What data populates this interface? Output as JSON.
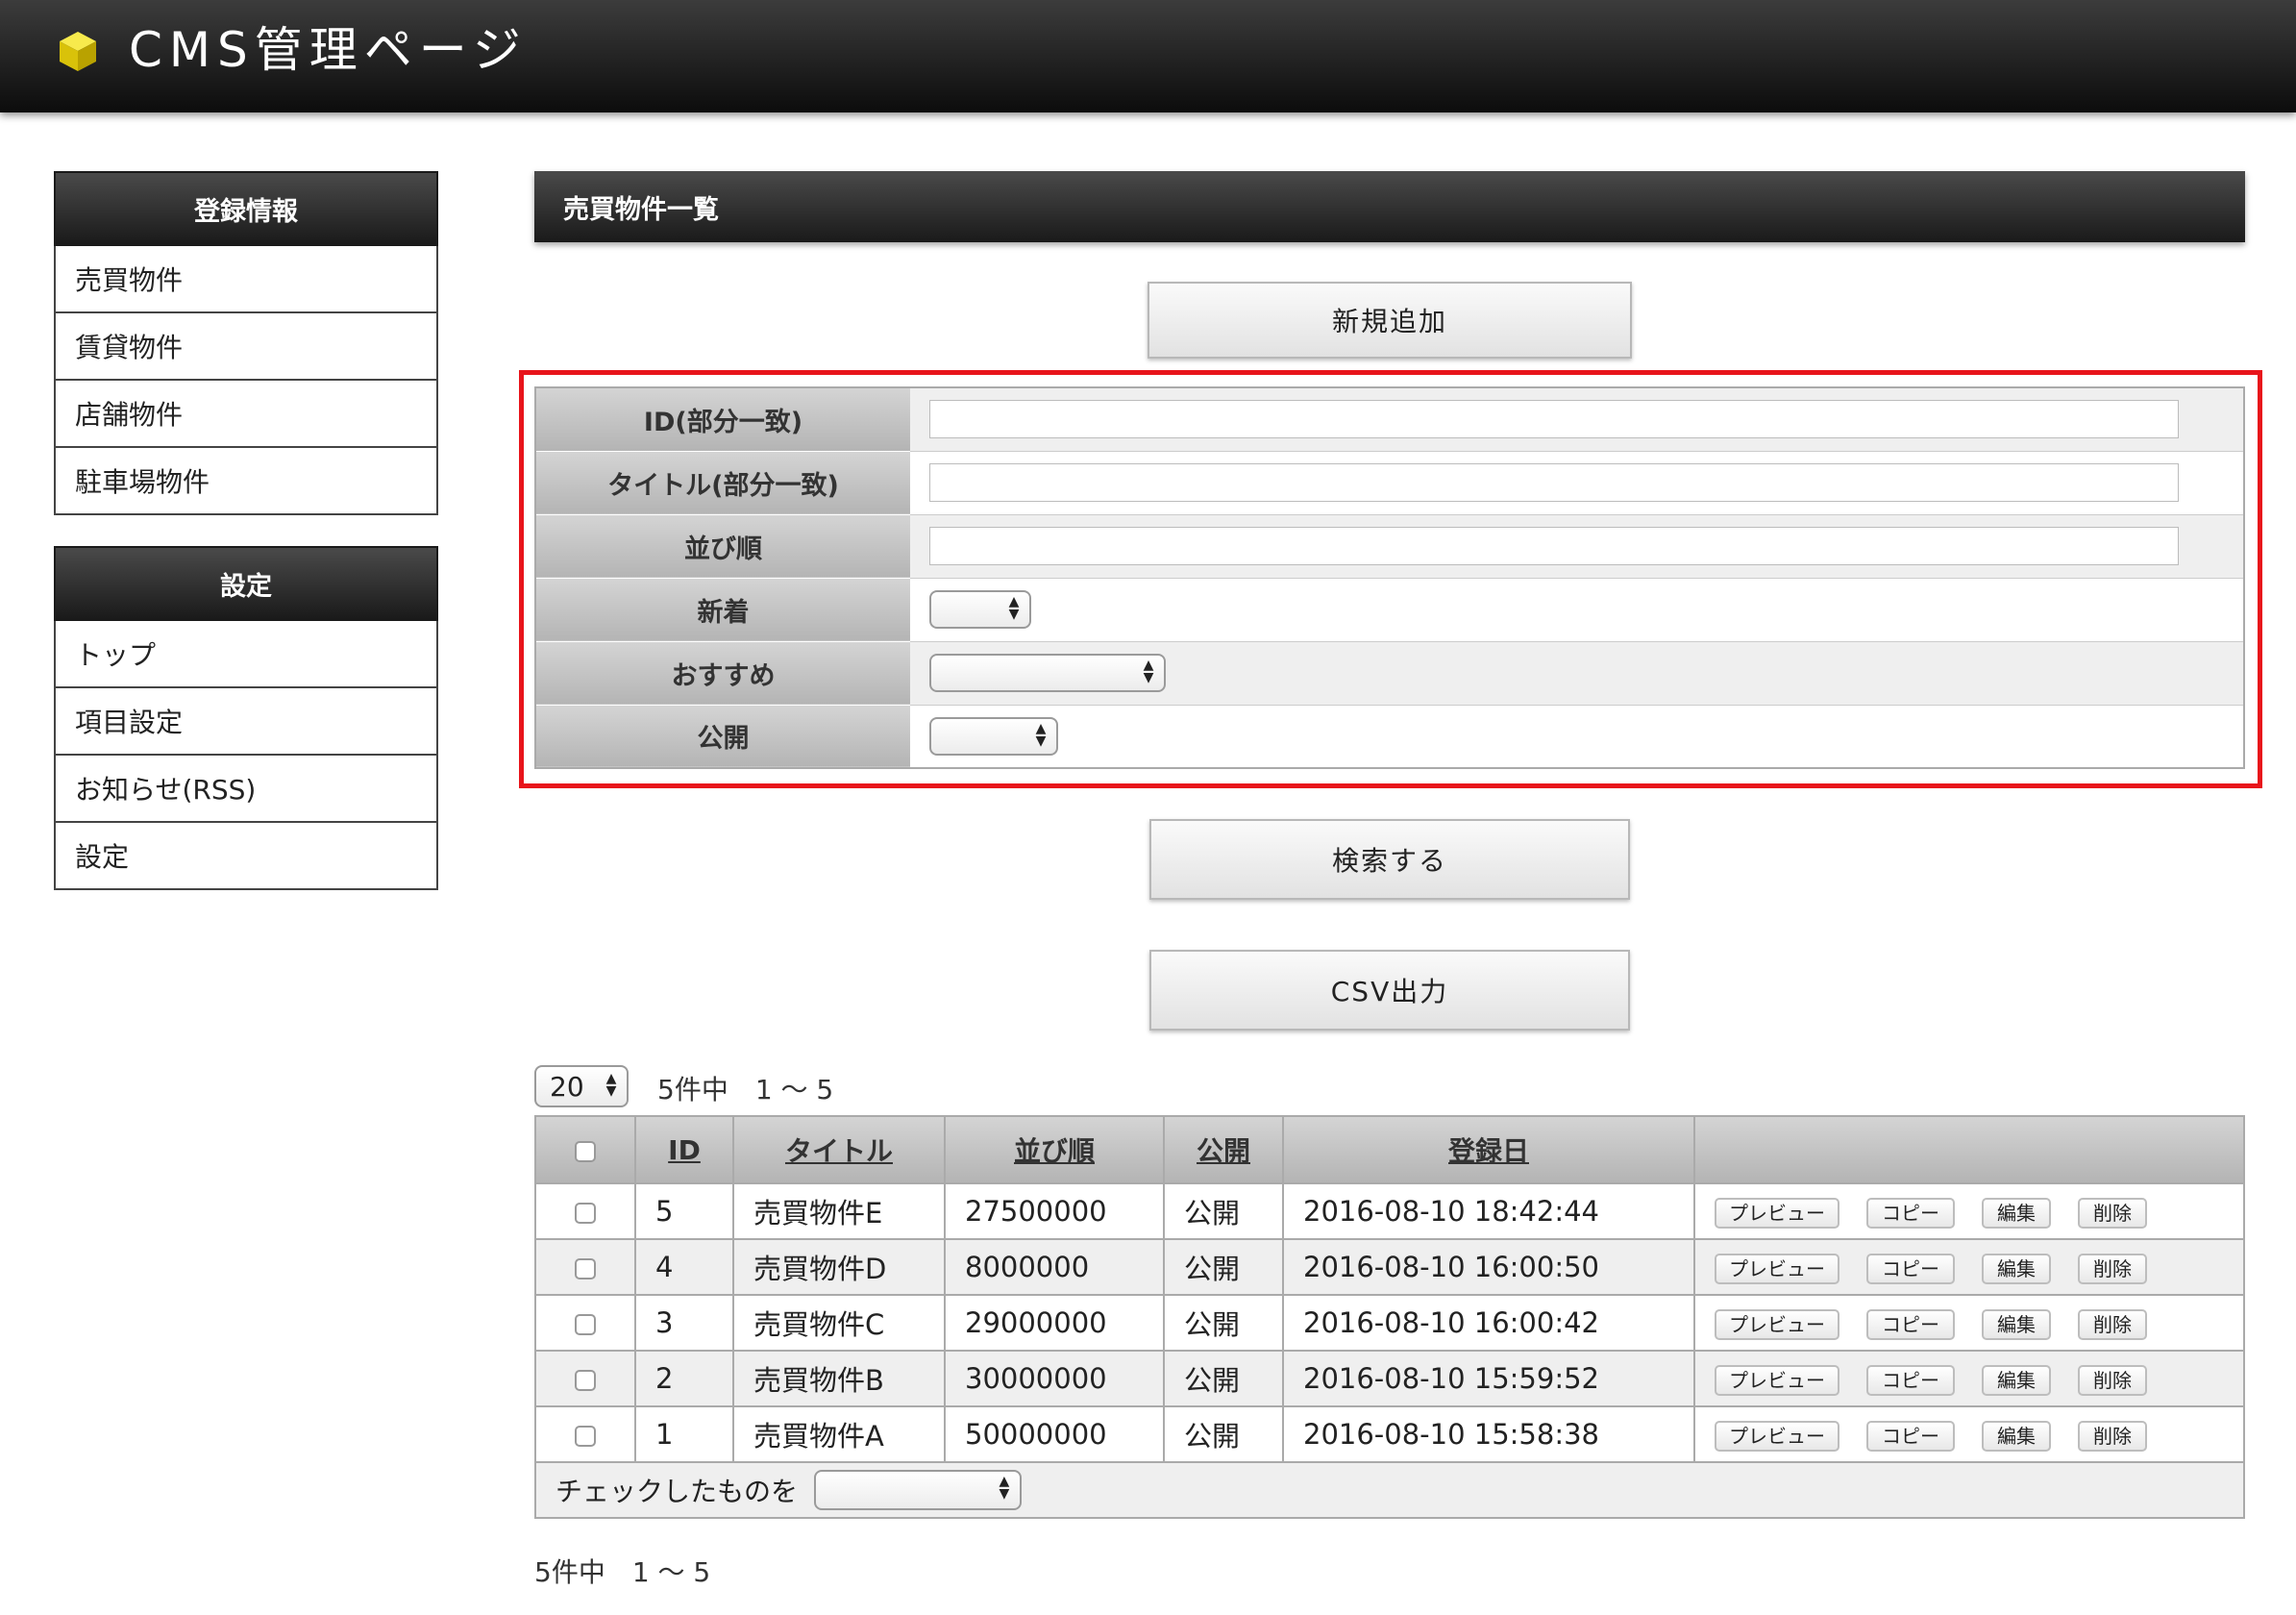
{
  "header": {
    "title": "CMS管理ページ",
    "logo_icon": "yellow-cube-icon",
    "logo_color": "#e5d20b"
  },
  "sidebar": {
    "groups": [
      {
        "title": "登録情報",
        "items": [
          "売買物件",
          "賃貸物件",
          "店舗物件",
          "駐車場物件"
        ]
      },
      {
        "title": "設定",
        "items": [
          "トップ",
          "項目設定",
          "お知らせ(RSS)",
          "設定"
        ]
      }
    ]
  },
  "main": {
    "section_title": "売買物件一覧",
    "add_button": "新規追加",
    "search_form": {
      "fields": [
        {
          "label": "ID(部分一致)",
          "type": "text",
          "value": ""
        },
        {
          "label": "タイトル(部分一致)",
          "type": "text",
          "value": ""
        },
        {
          "label": "並び順",
          "type": "text",
          "value": ""
        },
        {
          "label": "新着",
          "type": "select",
          "value": ""
        },
        {
          "label": "おすすめ",
          "type": "select",
          "value": ""
        },
        {
          "label": "公開",
          "type": "select",
          "value": ""
        }
      ],
      "highlight_color": "#e8141b"
    },
    "search_button": "検索する",
    "csv_button": "CSV出力",
    "per_page": "20",
    "count_top": "5件中　1 ～ 5",
    "count_bottom": "5件中　1 ～ 5",
    "table": {
      "columns": [
        "ID",
        "タイトル",
        "並び順",
        "公開",
        "登録日"
      ],
      "actions": [
        "プレビュー",
        "コピー",
        "編集",
        "削除"
      ],
      "rows": [
        {
          "id": "5",
          "title": "売買物件E",
          "order": "27500000",
          "status": "公開",
          "date": "2016-08-10 18:42:44"
        },
        {
          "id": "4",
          "title": "売買物件D",
          "order": "8000000",
          "status": "公開",
          "date": "2016-08-10 16:00:50"
        },
        {
          "id": "3",
          "title": "売買物件C",
          "order": "29000000",
          "status": "公開",
          "date": "2016-08-10 16:00:42"
        },
        {
          "id": "2",
          "title": "売買物件B",
          "order": "30000000",
          "status": "公開",
          "date": "2016-08-10 15:59:52"
        },
        {
          "id": "1",
          "title": "売買物件A",
          "order": "50000000",
          "status": "公開",
          "date": "2016-08-10 15:58:38"
        }
      ],
      "bulk_label": "チェックしたものを",
      "bulk_value": ""
    }
  }
}
